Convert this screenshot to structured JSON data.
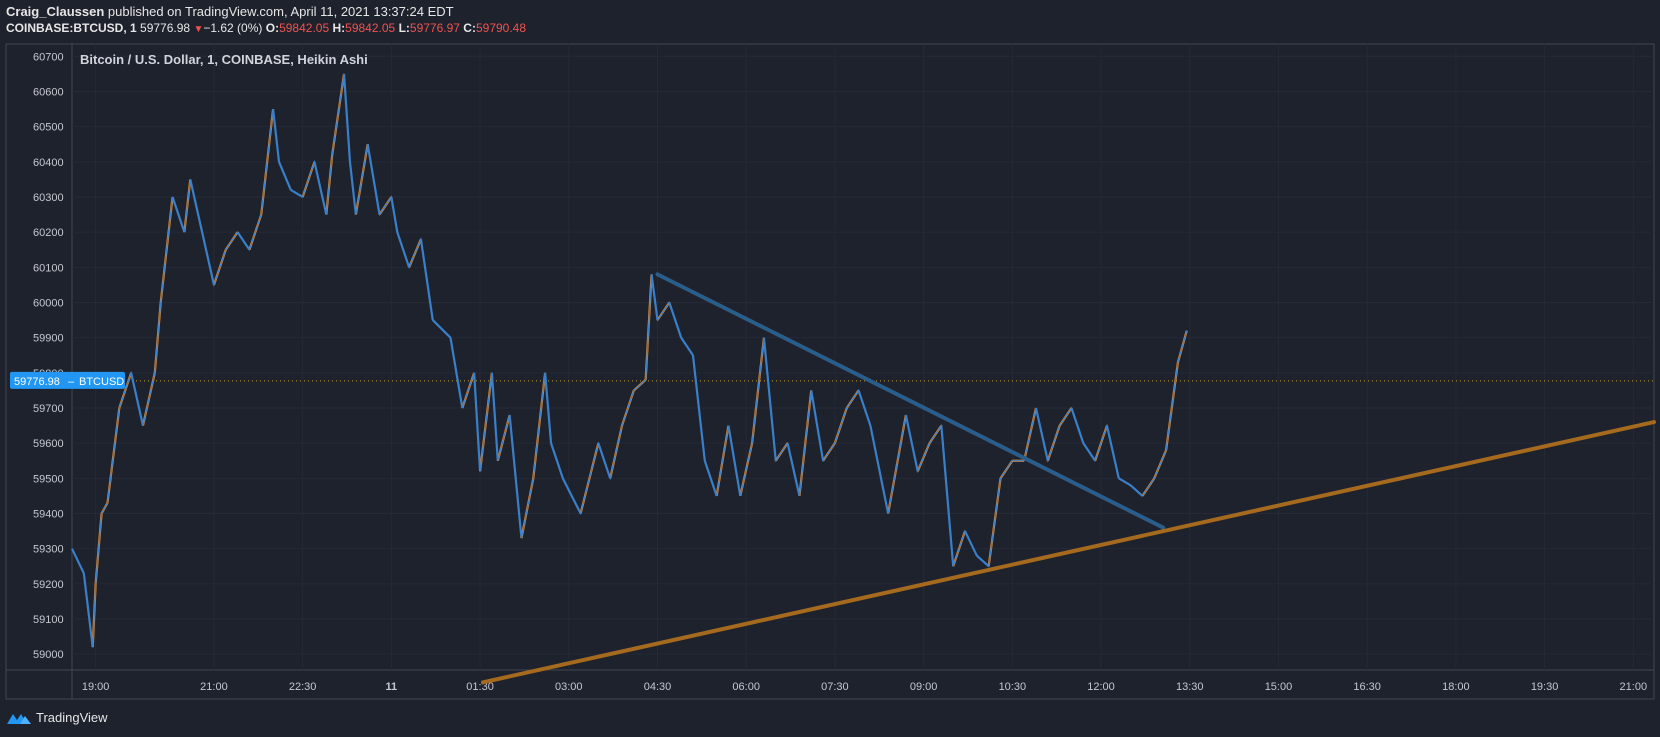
{
  "header": {
    "author": "Craig_Claussen",
    "published_text": "published on TradingView.com, April 11, 2021 13:37:24 EDT",
    "symbol": "COINBASE:BTCUSD, 1",
    "last": "59776.98",
    "change_arrow": "▼",
    "change": "−1.62 (0%)",
    "o_label": "O:",
    "o": "59842.05",
    "h_label": "H:",
    "h": "59842.05",
    "l_label": "L:",
    "l": "59776.97",
    "c_label": "C:",
    "c": "59790.48"
  },
  "chart_title": "Bitcoin / U.S. Dollar, 1, COINBASE, Heikin Ashi",
  "price_tag": {
    "value": "59776.98",
    "symbol": "BTCUSD"
  },
  "footer": {
    "brand": "TradingView"
  },
  "colors": {
    "up": "#e68a2e",
    "down": "#3a7fc9",
    "resistance": "#2a5d8a",
    "support": "#a56a1e",
    "background": "#1e222d",
    "accent": "#2196f3"
  },
  "chart_data": {
    "type": "line",
    "title": "Bitcoin / U.S. Dollar, 1, COINBASE, Heikin Ashi",
    "y_ticks": [
      59000,
      59100,
      59200,
      59300,
      59400,
      59500,
      59600,
      59700,
      59800,
      59900,
      60000,
      60100,
      60200,
      60300,
      60400,
      60500,
      60600,
      60700
    ],
    "ylim": [
      58955,
      60735
    ],
    "x_ticks": [
      "19:00",
      "21:00",
      "22:30",
      "11",
      "01:30",
      "03:00",
      "04:30",
      "06:00",
      "07:30",
      "09:00",
      "10:30",
      "12:00",
      "13:30",
      "15:00",
      "16:30",
      "18:00",
      "19:30",
      "21:00"
    ],
    "x_tick_hours": [
      19,
      21,
      22.5,
      24,
      25.5,
      27,
      28.5,
      30,
      31.5,
      33,
      34.5,
      36,
      37.5,
      39,
      40.5,
      42,
      43.5,
      45
    ],
    "xlim": [
      18.6,
      45.35
    ],
    "last_price": 59776.98,
    "series": [
      {
        "hours": [
          18.6,
          18.8,
          18.95,
          19,
          19.1,
          19.2,
          19.4,
          19.6,
          19.8,
          20,
          20.1,
          20.3,
          20.5,
          20.6,
          20.8,
          21,
          21.2,
          21.4,
          21.6,
          21.8,
          22,
          22.1,
          22.3,
          22.5,
          22.7,
          22.9,
          23,
          23.2,
          23.3,
          23.4,
          23.6,
          23.8,
          24,
          24.1,
          24.3,
          24.5,
          24.7,
          25,
          25.2,
          25.4,
          25.5,
          25.7,
          25.8,
          26,
          26.2,
          26.4,
          26.6,
          26.7,
          26.9,
          27.2,
          27.5,
          27.7,
          27.9,
          28.1,
          28.3,
          28.4,
          28.5,
          28.7,
          28.9,
          29.1,
          29.3,
          29.5,
          29.7,
          29.9,
          30.1,
          30.3,
          30.5,
          30.7,
          30.9,
          31.1,
          31.3,
          31.5,
          31.7,
          31.9,
          32.1,
          32.4,
          32.7,
          32.9,
          33.1,
          33.3,
          33.5,
          33.7,
          33.9,
          34.1,
          34.3,
          34.5,
          34.7,
          34.9,
          35.1,
          35.3,
          35.5,
          35.7,
          35.9,
          36.1,
          36.3,
          36.5,
          36.7,
          36.9,
          37.1,
          37.3,
          37.45
        ],
        "values": [
          59300,
          59230,
          59020,
          59200,
          59400,
          59430,
          59700,
          59800,
          59650,
          59800,
          60000,
          60300,
          60200,
          60350,
          60200,
          60050,
          60150,
          60200,
          60150,
          60250,
          60550,
          60400,
          60320,
          60300,
          60400,
          60250,
          60420,
          60650,
          60400,
          60250,
          60450,
          60250,
          60300,
          60200,
          60100,
          60180,
          59950,
          59900,
          59700,
          59800,
          59520,
          59800,
          59550,
          59680,
          59330,
          59500,
          59800,
          59600,
          59500,
          59400,
          59600,
          59500,
          59650,
          59750,
          59780,
          60080,
          59950,
          60000,
          59900,
          59850,
          59550,
          59450,
          59650,
          59450,
          59600,
          59900,
          59550,
          59600,
          59450,
          59750,
          59550,
          59600,
          59700,
          59750,
          59650,
          59400,
          59680,
          59520,
          59600,
          59650,
          59250,
          59350,
          59280,
          59250,
          59500,
          59550,
          59550,
          59700,
          59550,
          59650,
          59700,
          59600,
          59550,
          59650,
          59500,
          59480,
          59450,
          59500,
          59580,
          59830,
          59920
        ]
      }
    ],
    "trendlines": [
      {
        "name": "resistance",
        "from": [
          28.5,
          60080
        ],
        "to": [
          37.05,
          59360
        ]
      },
      {
        "name": "support",
        "from": [
          25.55,
          58920
        ],
        "to": [
          45.35,
          59660
        ]
      }
    ]
  }
}
